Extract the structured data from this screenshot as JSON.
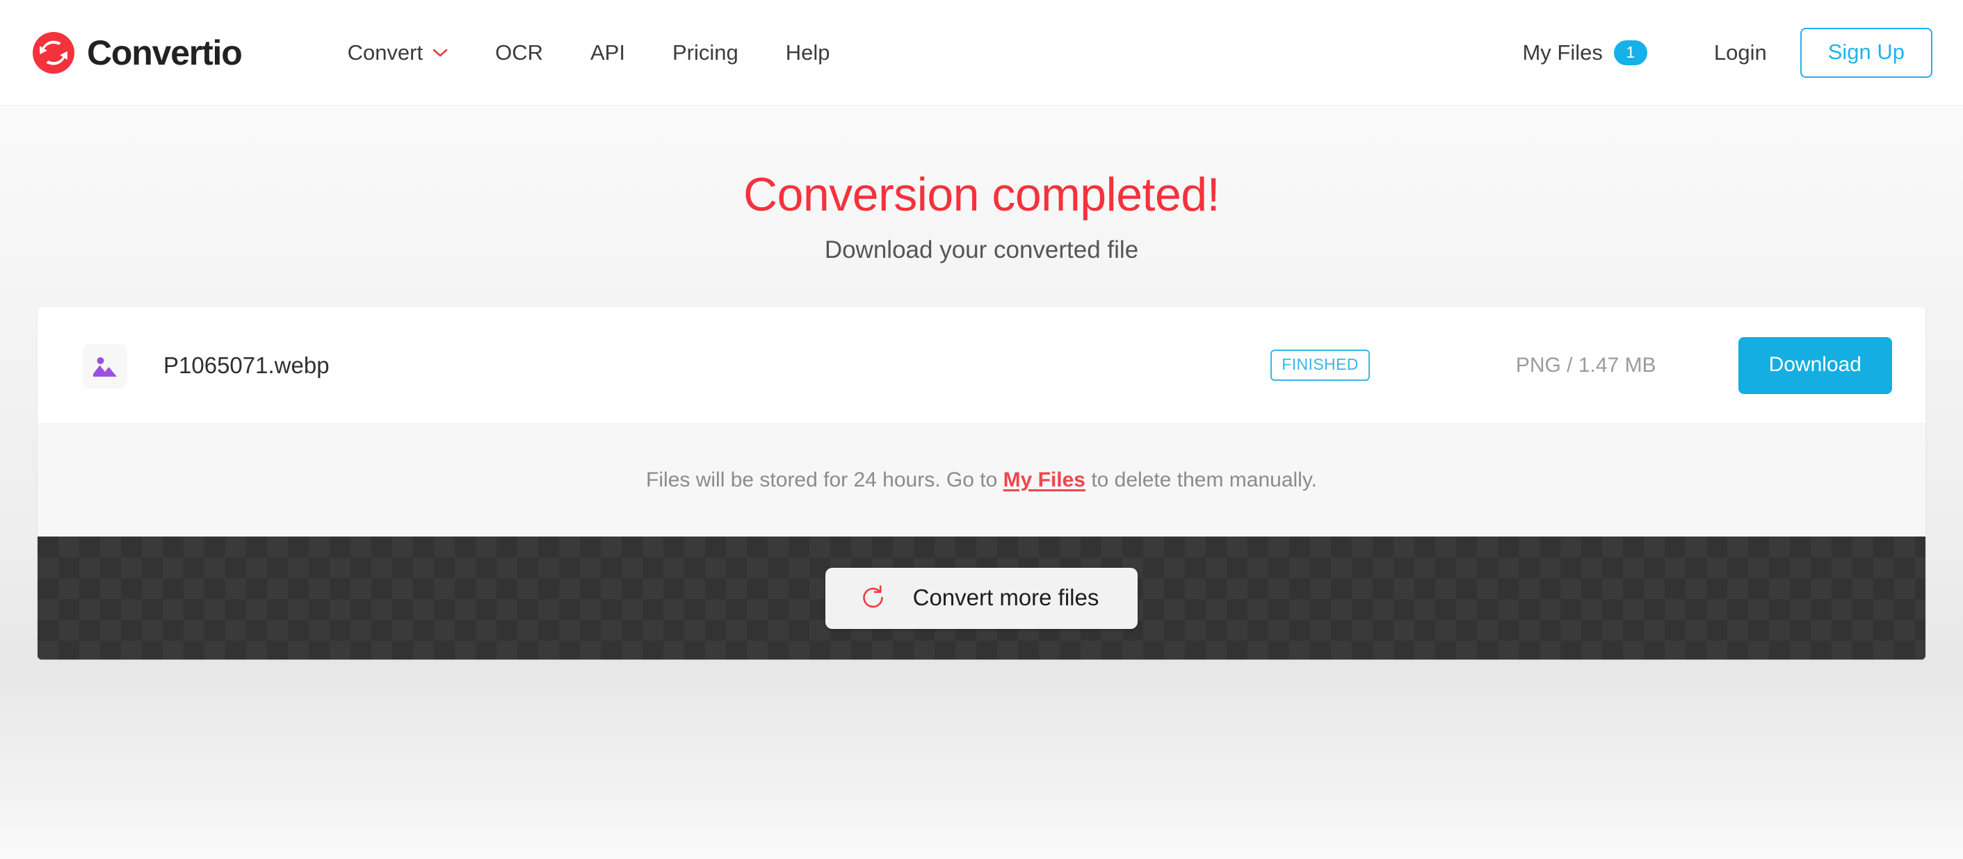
{
  "header": {
    "brand": {
      "name": "Convertio",
      "logo_icon": "convertio-logo-icon",
      "accent": "#f4323c"
    },
    "nav": [
      {
        "label": "Convert",
        "has_dropdown": true,
        "icon": "chevron-down-icon"
      },
      {
        "label": "OCR",
        "has_dropdown": false
      },
      {
        "label": "API",
        "has_dropdown": false
      },
      {
        "label": "Pricing",
        "has_dropdown": false
      },
      {
        "label": "Help",
        "has_dropdown": false
      }
    ],
    "my_files": {
      "label": "My Files",
      "count": "1",
      "badge_color": "#16b1e8"
    },
    "login": {
      "label": "Login"
    },
    "signup": {
      "label": "Sign Up",
      "color": "#22b2ec"
    }
  },
  "main": {
    "title": "Conversion completed!",
    "subtitle": "Download your converted file"
  },
  "card": {
    "file": {
      "icon": "image-file-icon",
      "name": "P1065071.webp",
      "status": "FINISHED",
      "status_color": "#38b6e8",
      "meta": "PNG / 1.47 MB",
      "download_label": "Download",
      "download_color": "#14aee2"
    },
    "notice": {
      "before_link": "Files will be stored for 24 hours. Go to ",
      "link": "My Files",
      "after_link": " to delete them manually.",
      "link_color": "#f0454d"
    },
    "footer": {
      "convert_more_label": "Convert more files",
      "icon": "refresh-icon",
      "icon_color": "#ee3b43"
    }
  }
}
